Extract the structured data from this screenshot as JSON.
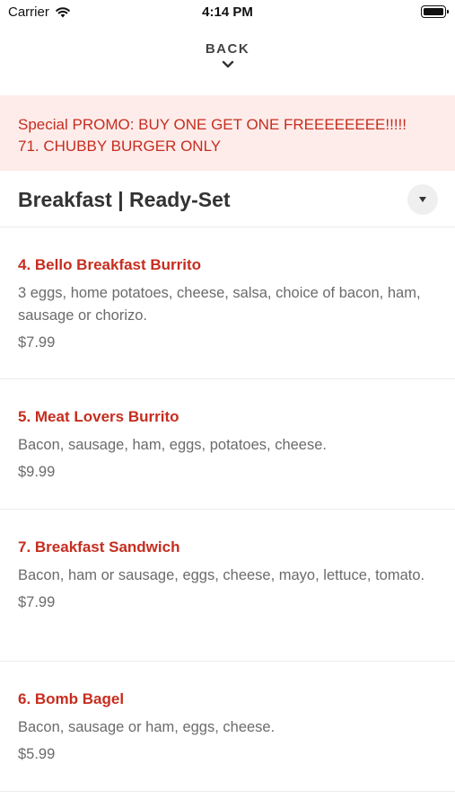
{
  "status_bar": {
    "carrier": "Carrier",
    "time": "4:14 PM",
    "icons": [
      "wifi-icon",
      "battery-icon"
    ]
  },
  "nav": {
    "back_label": "BACK",
    "back_icon": "chevron-down-icon"
  },
  "promo": {
    "line1": "Special PROMO: BUY ONE GET ONE FREEEEEEEE!!!!!",
    "line2": "71. CHUBBY BURGER ONLY",
    "background": "#fdecea",
    "text_color": "#c62d1f"
  },
  "category": {
    "title": "Breakfast | Ready-Set",
    "toggle_icon": "caret-down-icon"
  },
  "menu_items": [
    {
      "name": "4. Bello Breakfast Burrito",
      "description": "3 eggs, home potatoes, cheese, salsa, choice of bacon, ham, sausage or chorizo.",
      "price": "$7.99"
    },
    {
      "name": "5. Meat Lovers Burrito",
      "description": "Bacon, sausage, ham, eggs, potatoes, cheese.",
      "price": "$9.99"
    },
    {
      "name": "7. Breakfast Sandwich",
      "description": "Bacon, ham or sausage, eggs, cheese, mayo, lettuce, tomato.",
      "price": "$7.99"
    },
    {
      "name": "6. Bomb Bagel",
      "description": "Bacon, sausage or ham, eggs, cheese.",
      "price": "$5.99"
    }
  ],
  "colors": {
    "accent": "#c62d1f",
    "text_primary": "#333333",
    "text_secondary": "#6b6b6b",
    "divider": "#ececec"
  }
}
